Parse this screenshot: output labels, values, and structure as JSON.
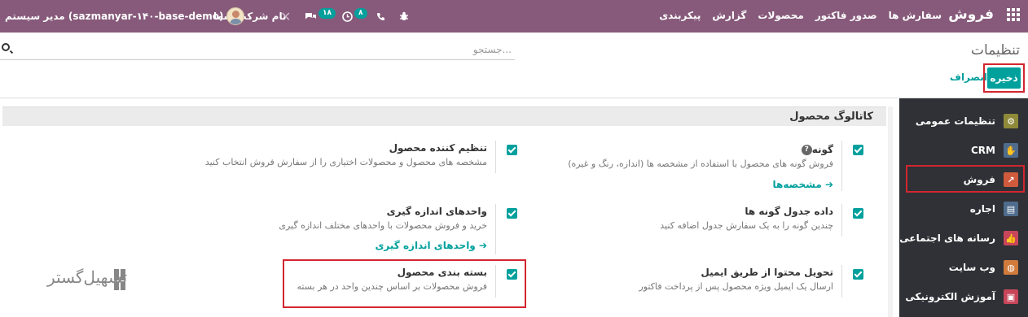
{
  "navbar": {
    "brand": "فروش",
    "menu": [
      "سفارش ها",
      "صدور فاکتور",
      "محصولات",
      "گزارش",
      "پیکربندی"
    ],
    "activity_count": "۸",
    "message_count": "۱۸",
    "company": "نام شرکت شما",
    "user": "مدیر سیستم (sazmanyar-۱۴۰-base-demo)"
  },
  "control_panel": {
    "title": "تنظیمات",
    "search_placeholder": "جستجو...",
    "save_label": "ذخیره",
    "discard_label": "انصراف"
  },
  "sidebar": {
    "items": [
      {
        "label": "تنظیمات عمومی",
        "icon": "gear-icon",
        "color": "#8f8a3a"
      },
      {
        "label": "CRM",
        "icon": "handshake-icon",
        "color": "#4f6c8c"
      },
      {
        "label": "فروش",
        "icon": "chart-icon",
        "color": "#d05a3c"
      },
      {
        "label": "اجاره",
        "icon": "rental-icon",
        "color": "#4f6c8c"
      },
      {
        "label": "رسانه های اجتماعی",
        "icon": "thumbs-up-icon",
        "color": "#c8465a"
      },
      {
        "label": "وب سایت",
        "icon": "globe-icon",
        "color": "#d07a3c"
      },
      {
        "label": "آموزش الکترونیکی",
        "icon": "elearning-icon",
        "color": "#c8465a"
      }
    ]
  },
  "section": {
    "title": "کاتالوگ محصول",
    "settings": [
      {
        "title": "گونه",
        "desc": "فروش گونه های محصول با استفاده از مشخصه ها (اندازه، رنگ و غیره)",
        "link": "مشخصه‌ها",
        "checked": true
      },
      {
        "title": "تنظیم کننده محصول",
        "desc": "مشخصه های محصول و محصولات اختیاری را از سفارش فروش انتخاب کنید",
        "checked": true
      },
      {
        "title": "داده جدول گونه ها",
        "desc": "چندین گونه را به یک سفارش جدول اضافه کنید",
        "checked": true
      },
      {
        "title": "واحدهای اندازه گیری",
        "desc": "خرید و فروش محصولات با واحدهای مختلف اندازه گیری",
        "link": "واحدهای اندازه گیری",
        "checked": true
      },
      {
        "title": "تحویل محتوا از طریق ایمیل",
        "desc": "ارسال یک ایمیل ویژه محصول پس از پرداخت فاکتور",
        "checked": true
      },
      {
        "title": "بسته بندی محصول",
        "desc": "فروش محصولات بر اساس چندین واحد در هر بسته",
        "checked": true
      }
    ]
  },
  "watermark": "تسهیل‌گستر"
}
